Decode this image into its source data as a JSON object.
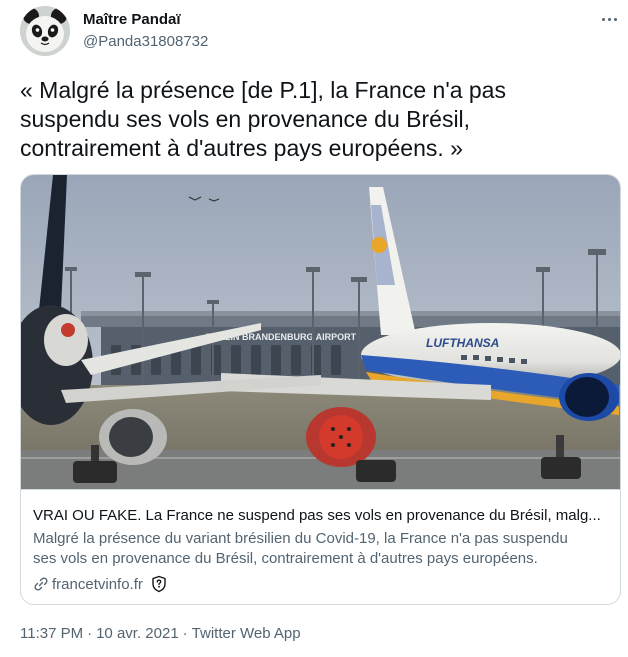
{
  "author": {
    "name": "Maître Pandaï",
    "handle": "@Panda31808732",
    "avatar_icon": "panda-avatar"
  },
  "tweet": {
    "text_lines": [
      "« Malgré la présence [de P.1], la France n'a pas",
      "suspendu ses vols en provenance du Brésil,",
      "contrairement à d'autres pays européens. »"
    ]
  },
  "card": {
    "image_sign": "BERLIN BRANDENBURG AIRPORT",
    "title": "VRAI OU FAKE. La France ne suspend pas ses vols en provenance du Brésil, malg...",
    "description_lines": [
      "Malgré la présence du variant brésilien du Covid-19, la France n'a pas suspendu",
      "ses vols en provenance du Brésil, contrairement à d'autres pays européens."
    ],
    "domain": "francetvinfo.fr",
    "link_icon": "link-icon",
    "badge_icon": "shield-question-icon"
  },
  "meta": {
    "time": "11:37 PM",
    "date": "10 avr. 2021",
    "source": "Twitter Web App",
    "separator": "·"
  },
  "colors": {
    "text_primary": "#0f1419",
    "text_secondary": "#536471",
    "border": "#cfd9de"
  }
}
